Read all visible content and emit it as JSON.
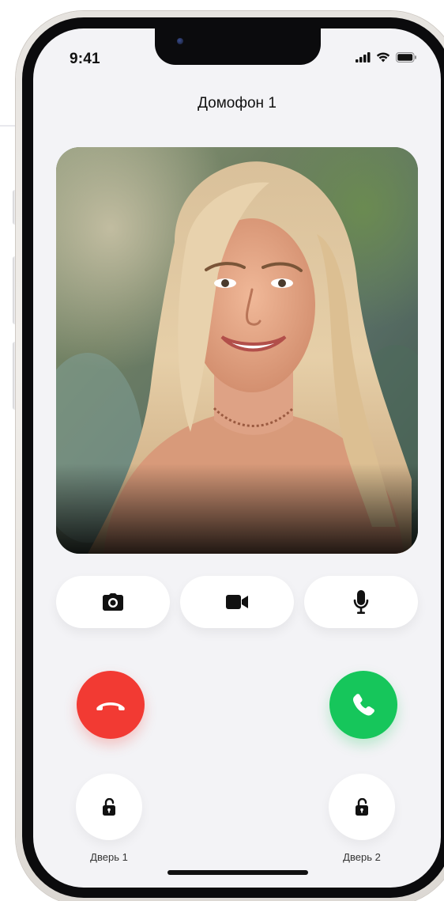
{
  "status_bar": {
    "time": "9:41",
    "icons": [
      "cellular-signal-icon",
      "wifi-icon",
      "battery-icon"
    ]
  },
  "header": {
    "title": "Домофон 1"
  },
  "video": {
    "description_icon": "intercom-camera-feed"
  },
  "controls": [
    {
      "name": "snapshot-button",
      "icon": "camera-icon"
    },
    {
      "name": "video-toggle-button",
      "icon": "video-camera-icon"
    },
    {
      "name": "microphone-button",
      "icon": "microphone-icon"
    }
  ],
  "call": {
    "decline_icon": "hang-up-icon",
    "accept_icon": "phone-icon",
    "colors": {
      "decline": "#f23a33",
      "accept": "#16c65b"
    }
  },
  "doors": [
    {
      "label": "Дверь 1",
      "icon": "unlock-icon"
    },
    {
      "label": "Дверь 2",
      "icon": "unlock-icon"
    }
  ]
}
